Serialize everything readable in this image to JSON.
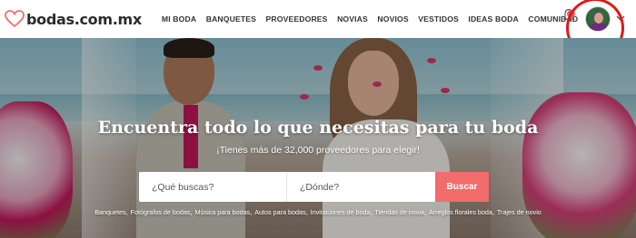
{
  "brand": {
    "name": "bodas.com.mx",
    "accent": "#f26c6c"
  },
  "nav": {
    "items": [
      {
        "label": "MI BODA"
      },
      {
        "label": "BANQUETES"
      },
      {
        "label": "PROVEEDORES"
      },
      {
        "label": "NOVIAS"
      },
      {
        "label": "NOVIOS"
      },
      {
        "label": "VESTIDOS"
      },
      {
        "label": "IDEAS BODA"
      },
      {
        "label": "COMUNIDAD"
      }
    ]
  },
  "header_right": {
    "notification_icon": "bell-icon",
    "avatar_icon": "user-avatar",
    "menu_icon": "chevron-down-icon"
  },
  "hero": {
    "title": "Encuentra todo lo que necesitas para tu boda",
    "subtitle": "¡Tienes más de 32,000 proveedores para elegir!"
  },
  "search": {
    "what_placeholder": "¿Qué buscas?",
    "where_placeholder": "¿Dónde?",
    "button_label": "Buscar"
  },
  "quick_links": [
    {
      "label": "Banquetes"
    },
    {
      "label": "Fotógrafos de bodas"
    },
    {
      "label": "Música para bodas"
    },
    {
      "label": "Autos para bodas"
    },
    {
      "label": "Invitaciones de boda"
    },
    {
      "label": "Tiendas de novia"
    },
    {
      "label": "Arreglos florales boda"
    },
    {
      "label": "Trajes de novio"
    }
  ]
}
